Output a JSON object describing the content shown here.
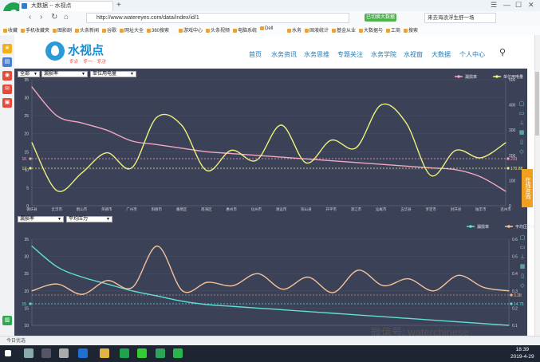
{
  "browser": {
    "tab_title": "大数据 -- 水视点",
    "new_tab": "+",
    "url": "http://www.watereyes.com/data/index/id/1",
    "badge": "已切换大数据",
    "search_text": "来去海浪浮生舒一场",
    "app_glyph": "e",
    "back": "‹",
    "forward": "›",
    "reload": "↻",
    "home": "⌂",
    "menu_glyphs": [
      "☰",
      "—",
      "☐",
      "✕"
    ]
  },
  "bookmarks": [
    "收藏",
    "手机收藏夹",
    "图影剧",
    "头条新闻",
    "谷歌",
    "网址大全",
    "360搜索",
    "游戏中心",
    "头条视频",
    "电脑系统",
    "Dell",
    "水务",
    "固液统计",
    "基金从业",
    "大数据与",
    "工商",
    "搜索"
  ],
  "site": {
    "logo_text": "水视点",
    "slogan": "专业 · 专一 · 专注",
    "menu": [
      "首页",
      "水务资讯",
      "水务思维",
      "专题关注",
      "水务学院",
      "水视窗",
      "大数据",
      "个人中心"
    ],
    "search_icon": "search-icon",
    "float_tab": "在线咨询"
  },
  "chart1": {
    "selects": [
      "全部",
      "漏损率",
      "单位用电量"
    ],
    "legend": [
      "漏损率",
      "单位用电量"
    ],
    "left_ticks": [
      "35",
      "30",
      "25",
      "20",
      "15",
      "10",
      "5",
      "0"
    ],
    "right_ticks": [
      "500",
      "400",
      "300",
      "200",
      "100",
      "0"
    ],
    "marker_left_pink": "15",
    "marker_left_yellow": "12",
    "marker_right_pink": "233",
    "marker_right_yellow": "170.88",
    "x_labels": [
      "德庆县",
      "云浮市",
      "鹤山市",
      "英德市",
      "广州市",
      "阳春市",
      "番禺区",
      "南海区",
      "惠州市",
      "化州市",
      "清远市",
      "阳山县",
      "开平市",
      "湛江市",
      "汕尾市",
      "五华县",
      "罗定市",
      "封开县",
      "陆丰市",
      "连州市"
    ]
  },
  "chart2": {
    "selects": [
      "漏损率",
      "平均压力"
    ],
    "legend": [
      "漏损率",
      "平均压力(Mpa)"
    ],
    "left_ticks": [
      "35",
      "30",
      "25",
      "20",
      "15",
      "10"
    ],
    "right_ticks": [
      "0.6",
      "0.5",
      "0.4",
      "0.3",
      "0.2",
      "0.1"
    ],
    "marker_left": "15",
    "marker_right_a": "0.38",
    "marker_right_b": "14.75"
  },
  "chart_data": [
    {
      "type": "line",
      "title": "",
      "categories": [
        "德庆县",
        "云浮市",
        "鹤山市",
        "英德市",
        "广州市",
        "阳春市",
        "番禺区",
        "南海区",
        "惠州市",
        "化州市",
        "清远市",
        "阳山县",
        "开平市",
        "湛江市",
        "汕尾市",
        "五华县",
        "罗定市",
        "封开县",
        "陆丰市",
        "连州市"
      ],
      "series": [
        {
          "name": "漏损率",
          "axis": "left",
          "values": [
            33,
            25,
            23,
            21,
            18,
            17,
            16,
            15,
            14.5,
            14,
            13.5,
            13,
            12.5,
            12,
            11.5,
            11,
            10.5,
            10,
            8,
            4
          ]
        },
        {
          "name": "单位用电量",
          "axis": "right",
          "values": [
            250,
            60,
            130,
            210,
            150,
            350,
            320,
            140,
            220,
            180,
            320,
            170,
            260,
            230,
            400,
            330,
            120,
            220,
            190,
            250
          ]
        }
      ],
      "ylim_left": [
        0,
        35
      ],
      "ylim_right": [
        0,
        500
      ],
      "legend": "top-right"
    },
    {
      "type": "line",
      "title": "",
      "series": [
        {
          "name": "漏损率",
          "axis": "left",
          "values": [
            33,
            27,
            24,
            22,
            20,
            18.5,
            17,
            16,
            15.5,
            15,
            14.5,
            14,
            13.5,
            13,
            12.5,
            12,
            11.5,
            11,
            10.5,
            10
          ]
        },
        {
          "name": "平均压力(Mpa)",
          "axis": "right",
          "values": [
            0.3,
            0.34,
            0.28,
            0.36,
            0.32,
            0.56,
            0.3,
            0.35,
            0.33,
            0.4,
            0.31,
            0.38,
            0.29,
            0.42,
            0.33,
            0.37,
            0.3,
            0.39,
            0.32,
            0.3
          ]
        }
      ],
      "ylim_left": [
        10,
        35
      ],
      "ylim_right": [
        0.1,
        0.6
      ],
      "legend": "top-right"
    }
  ],
  "watermark": "微信号: waterchinese",
  "status": {
    "left": "今日优选",
    "time": "18:39",
    "date": "2019-4-29"
  },
  "colors": {
    "pink": "#f4a6c2",
    "yellow": "#eef27a",
    "cyan": "#5fe0d4",
    "peach": "#f5c39a",
    "chart_bg": "#3b4157",
    "orange": "#f0a020"
  }
}
